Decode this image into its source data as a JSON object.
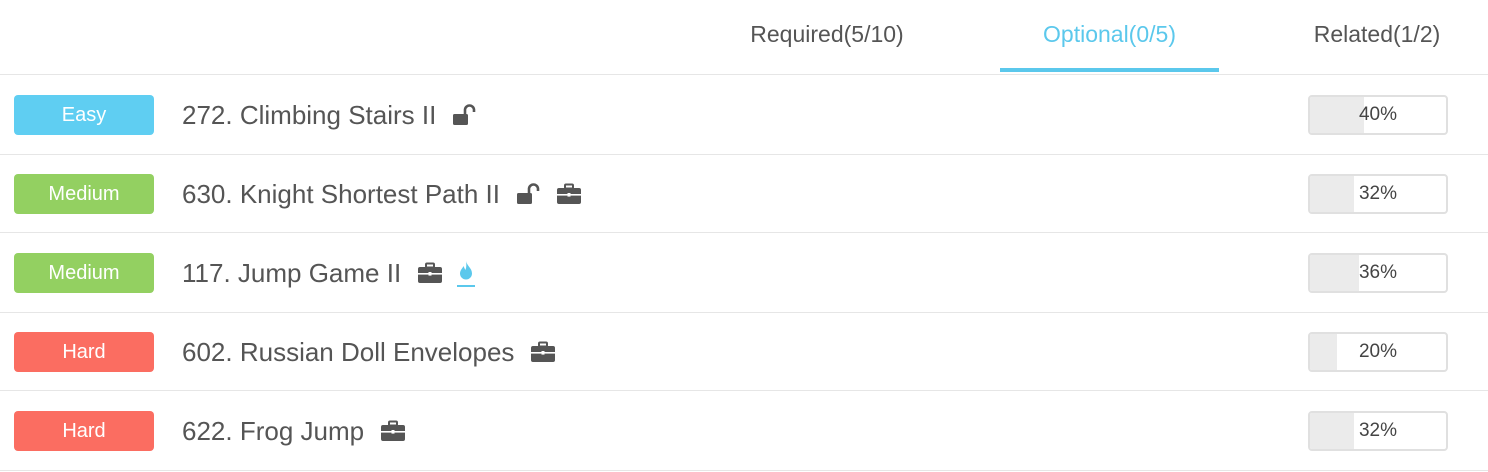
{
  "tabs": [
    {
      "label": "Required(5/10)",
      "active": false
    },
    {
      "label": "Optional(0/5)",
      "active": true
    },
    {
      "label": "Related(1/2)",
      "active": false
    }
  ],
  "colors": {
    "accent": "#5bc8ec",
    "easy": "#5fcef2",
    "medium": "#93d061",
    "hard": "#fb6d61",
    "icon": "#555555"
  },
  "problems": [
    {
      "difficulty": "Easy",
      "title": "272. Climbing Stairs II",
      "icons": [
        "unlock-icon"
      ],
      "progress_label": "40%",
      "progress": 40
    },
    {
      "difficulty": "Medium",
      "title": "630. Knight Shortest Path II",
      "icons": [
        "unlock-icon",
        "briefcase-icon"
      ],
      "progress_label": "32%",
      "progress": 32
    },
    {
      "difficulty": "Medium",
      "title": "117. Jump Game II",
      "icons": [
        "briefcase-icon",
        "fire-icon"
      ],
      "progress_label": "36%",
      "progress": 36
    },
    {
      "difficulty": "Hard",
      "title": "602. Russian Doll Envelopes",
      "icons": [
        "briefcase-icon"
      ],
      "progress_label": "20%",
      "progress": 20
    },
    {
      "difficulty": "Hard",
      "title": "622. Frog Jump",
      "icons": [
        "briefcase-icon"
      ],
      "progress_label": "32%",
      "progress": 32
    }
  ]
}
